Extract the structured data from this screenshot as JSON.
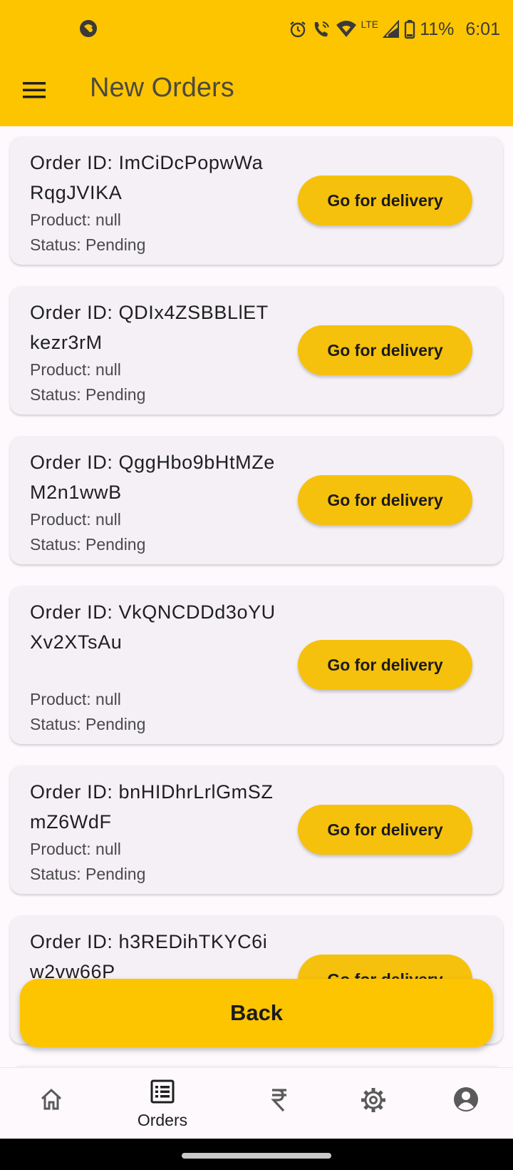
{
  "status_bar": {
    "battery_percent": "11%",
    "time": "6:01",
    "network_label": "LTE",
    "icons": [
      "app-notification-icon",
      "alarm-icon",
      "wifi-call-icon",
      "wifi-icon",
      "signal-icon",
      "battery-icon"
    ]
  },
  "header": {
    "title": "New Orders",
    "menu_icon": "hamburger-menu-icon"
  },
  "orders": [
    {
      "id_text": "Order ID: ImCiDcPopwWaRqgJVIKA",
      "product": "Product: null",
      "status": "Status: Pending",
      "action": "Go for delivery"
    },
    {
      "id_text": "Order ID: QDIx4ZSBBLlETkezr3rM",
      "product": "Product: null",
      "status": "Status: Pending",
      "action": "Go for delivery"
    },
    {
      "id_text": "Order ID: QggHbo9bHtMZeM2n1wwB",
      "product": "Product: null",
      "status": "Status: Pending",
      "action": "Go for delivery"
    },
    {
      "id_text": "Order ID: VkQNCDDd3oYUXv2XTsAu",
      "product": "Product: null",
      "status": "Status: Pending",
      "action": "Go for delivery"
    },
    {
      "id_text": "Order ID: bnHIDhrLrlGmSZmZ6WdF",
      "product": "Product: null",
      "status": "Status: Pending",
      "action": "Go for delivery"
    },
    {
      "id_text": "Order ID: h3REDihTKYC6iw2vw66P",
      "product": "",
      "status": "",
      "action": "Go for delivery"
    }
  ],
  "back_button": {
    "label": "Back"
  },
  "bottom_nav": [
    {
      "name": "home",
      "icon": "home-icon",
      "label": "",
      "active": false
    },
    {
      "name": "orders",
      "icon": "list-icon",
      "label": "Orders",
      "active": true
    },
    {
      "name": "earnings",
      "icon": "rupee-icon",
      "label": "",
      "active": false
    },
    {
      "name": "settings",
      "icon": "gear-icon",
      "label": "",
      "active": false
    },
    {
      "name": "profile",
      "icon": "account-icon",
      "label": "",
      "active": false
    }
  ]
}
